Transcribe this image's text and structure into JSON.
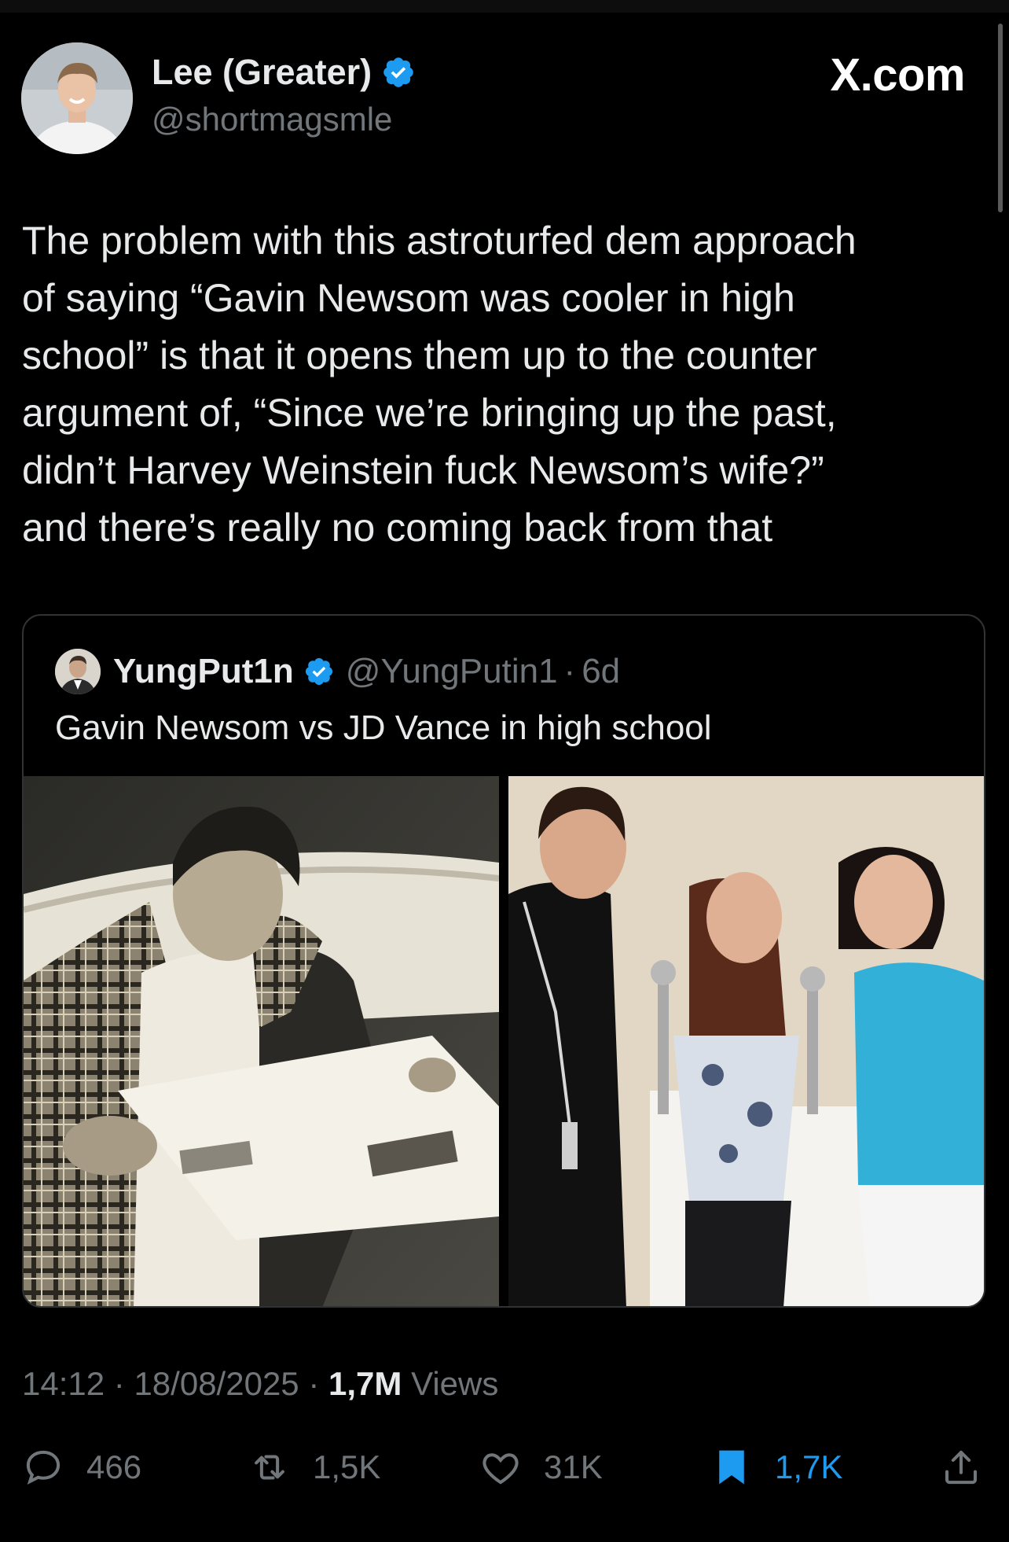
{
  "post": {
    "author_name": "Lee (Greater)",
    "author_handle": "@shortmagsmle",
    "brand": "X.com",
    "text": "The problem with this astroturfed dem approach\nof saying “Gavin Newsom was cooler in high\nschool” is that it opens them up to the counter\nargument of, “Since we’re bringing up the past,\ndidn’t Harvey Weinstein fuck Newsom’s wife?”\nand there’s really no coming back from that",
    "time": "14:12",
    "date": "18/08/2025",
    "views_count": "1,7M",
    "views_label": "Views",
    "separator": "·"
  },
  "quote": {
    "author_name": "YungPut1n",
    "author_handle": "@YungPutin1",
    "separator": "·",
    "age": "6d",
    "text": "Gavin Newsom vs JD Vance in high school"
  },
  "actions": {
    "replies": "466",
    "reposts": "1,5K",
    "likes": "31K",
    "bookmarks": "1,7K"
  },
  "colors": {
    "background": "#000000",
    "text_primary": "#e7e9ea",
    "text_secondary": "#71767b",
    "accent": "#1d9bf0",
    "border": "#2f3336"
  },
  "icons": [
    "verified-badge-icon",
    "reply-icon",
    "repost-icon",
    "like-icon",
    "bookmark-icon",
    "share-icon"
  ]
}
